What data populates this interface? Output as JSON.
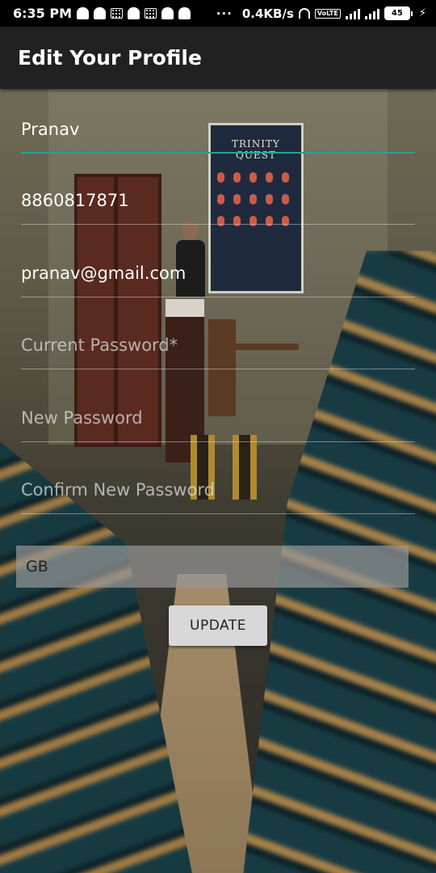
{
  "status_bar": {
    "time": "6:35 PM",
    "more": "···",
    "network_speed": "0.4KB/s",
    "volte": "VoLTE",
    "battery": "45"
  },
  "app_bar": {
    "title": "Edit Your Profile"
  },
  "poster": {
    "text": "TRINITY QUEST"
  },
  "form": {
    "name_value": "Pranav",
    "phone_value": "8860817871",
    "email_value": "pranav@gmail.com",
    "current_password_placeholder": "Current Password*",
    "new_password_placeholder": "New Password",
    "confirm_password_placeholder": "Confirm New Password",
    "spinner_selected": "GB",
    "update_label": "UPDATE"
  },
  "colors": {
    "accent": "#23a596",
    "app_bar": "#212121",
    "status_bar": "#000000"
  }
}
